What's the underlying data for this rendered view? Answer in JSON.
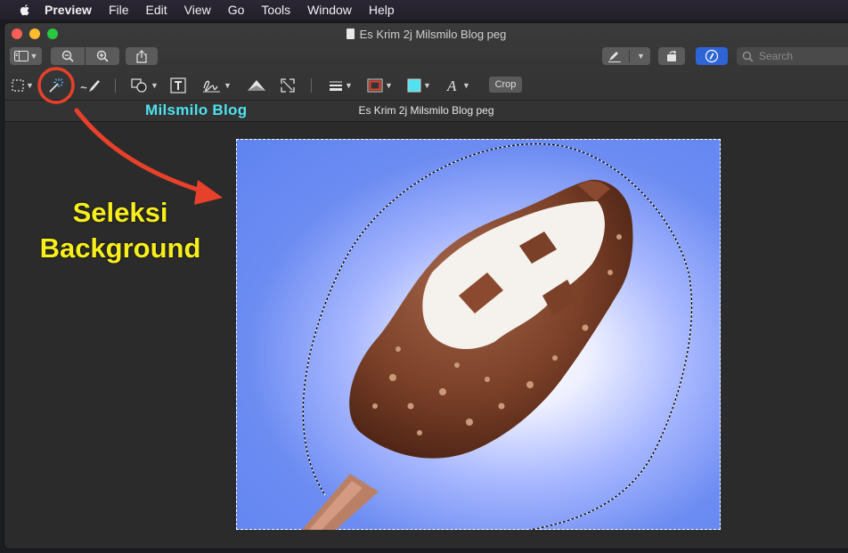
{
  "menubar": {
    "app": "Preview",
    "items": [
      "File",
      "Edit",
      "View",
      "Go",
      "Tools",
      "Window",
      "Help"
    ]
  },
  "window": {
    "title": "Es Krim 2j Milsmilo Blog peg",
    "subtitle": "Es Krim 2j Milsmilo Blog peg"
  },
  "toolbar": {
    "search_placeholder": "Search",
    "crop_label": "Crop"
  },
  "overlay": {
    "brand": "Milsmilo Blog",
    "annotation_line1": "Seleksi",
    "annotation_line2": "Background"
  },
  "icons": {
    "sidebar": "sidebar-icon",
    "zoom_out": "zoom-out-icon",
    "zoom_in": "zoom-in-icon",
    "share": "share-icon",
    "markup": "pen-icon",
    "rotate": "rotate-icon",
    "annotate": "markup-circle-icon",
    "selection": "rect-select-icon",
    "instant_alpha": "magic-wand-icon",
    "sketch": "sketch-icon",
    "shapes": "shapes-icon",
    "text": "text-icon",
    "sign": "signature-icon",
    "adjust_color": "adjust-color-icon",
    "adjust_size": "resize-icon",
    "line_style": "line-style-icon",
    "border_color": "border-color-icon",
    "fill_color": "fill-color-icon",
    "text_style": "text-style-icon"
  },
  "colors": {
    "annotation_red": "#e8412b",
    "annotation_yellow": "#f7ee1d",
    "brand_cyan": "#4fe3ef",
    "fill_swatch": "#4fe3ef",
    "border_swatch": "#e8412b"
  }
}
